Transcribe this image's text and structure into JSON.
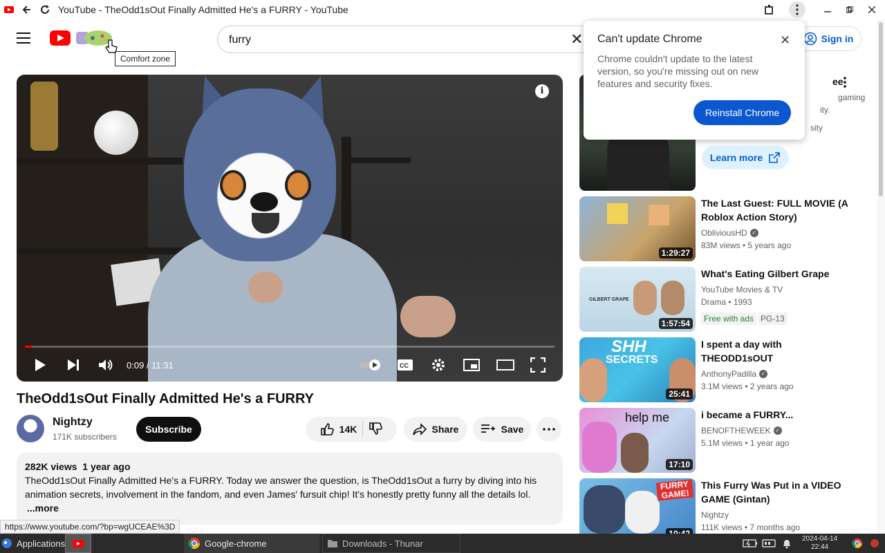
{
  "window": {
    "title": "YouTube - TheOdd1sOut Finally Admitted He's a FURRY - YouTube"
  },
  "header": {
    "search_value": "furry",
    "sign_in_label": "Sign in",
    "tooltip": "Comfort zone"
  },
  "player": {
    "time": "0:09 / 11:31",
    "progress_fraction": 0.013
  },
  "video": {
    "title": "TheOdd1sOut Finally Admitted He's a FURRY",
    "channel": "Nightzy",
    "subscribers": "171K subscribers",
    "subscribe_label": "Subscribe",
    "likes": "14K",
    "share_label": "Share",
    "save_label": "Save",
    "views_date": "282K views  1 year ago",
    "description": "TheOdd1sOut Finally Admitted He's a FURRY. Today we answer the question, is TheOdd1sOut a furry by diving into his animation secrets, involvement in the fandom, and even James' fursuit chip! It's honestly pretty funny all the details lol.",
    "more_label": "...more"
  },
  "popup": {
    "title": "Can't update Chrome",
    "body": "Chrome couldn't update to the latest version, so you're missing out on new features and security fixes.",
    "button": "Reinstall Chrome"
  },
  "first_rec": {
    "title_fragment": "ee",
    "line1": "gaming",
    "line2": "ity.",
    "line3": "sity",
    "learn_more": "Learn more"
  },
  "recommendations": [
    {
      "title": "The Last Guest: FULL MOVIE (A Roblox Action Story)",
      "channel": "ObliviousHD",
      "meta": "83M views  •  5 years ago",
      "duration": "1:29:27"
    },
    {
      "title": "What's Eating Gilbert Grape",
      "channel": "YouTube Movies & TV",
      "meta": "Drama • 1993",
      "duration": "1:57:54",
      "badge_free": "Free with ads",
      "badge_rating": "PG-13"
    },
    {
      "title": "I spent a day with THEODD1sOUT",
      "channel": "AnthonyPadilla",
      "meta": "3.1M views  •  2 years ago",
      "duration": "25:41"
    },
    {
      "title": "i became a FURRY...",
      "channel": "BENOFTHEWEEK",
      "meta": "5.1M views  •  1 year ago",
      "duration": "17:10"
    },
    {
      "title": "This Furry Was Put in a VIDEO GAME (Gintan)",
      "channel": "Nightzy",
      "meta": "111K views  •  7 months ago",
      "duration": "10:42"
    }
  ],
  "thumb_text": {
    "gilbert": "GILBERT GRAPE",
    "shh": "SHH",
    "secrets": "SECRETS",
    "help_me": "help me",
    "furry_game": "FURRY GAME!"
  },
  "status_url": "https://www.youtube.com/?bp=wgUCEAE%3D",
  "taskbar": {
    "applications": "Applications",
    "chrome": "Google-chrome",
    "thunar": "Downloads - Thunar",
    "date": "2024-04-14",
    "time": "22:44"
  }
}
